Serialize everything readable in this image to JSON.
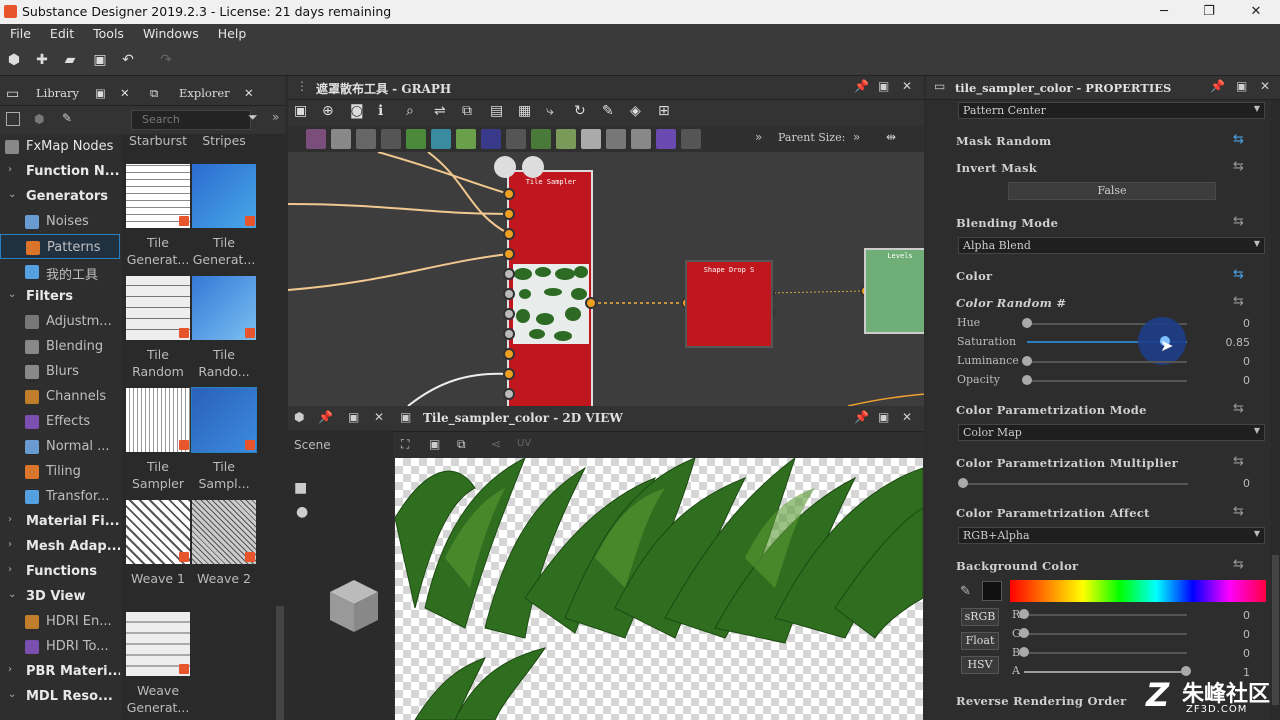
{
  "app": {
    "title": "Substance Designer 2019.2.3 - License: 21 days remaining"
  },
  "menu": [
    "File",
    "Edit",
    "Tools",
    "Windows",
    "Help"
  ],
  "library": {
    "tab_library": "Library",
    "tab_explorer": "Explorer",
    "search_placeholder": "Search",
    "tree": [
      {
        "label": "FxMap Nodes",
        "kind": "top"
      },
      {
        "label": "Function N...",
        "kind": "cat"
      },
      {
        "label": "Generators",
        "kind": "cat",
        "open": true
      },
      {
        "label": "Noises",
        "kind": "sub"
      },
      {
        "label": "Patterns",
        "kind": "sub",
        "selected": true
      },
      {
        "label": "我的工具",
        "kind": "sub"
      },
      {
        "label": "Filters",
        "kind": "cat",
        "open": true
      },
      {
        "label": "Adjustm...",
        "kind": "sub"
      },
      {
        "label": "Blending",
        "kind": "sub"
      },
      {
        "label": "Blurs",
        "kind": "sub"
      },
      {
        "label": "Channels",
        "kind": "sub"
      },
      {
        "label": "Effects",
        "kind": "sub"
      },
      {
        "label": "Normal ...",
        "kind": "sub"
      },
      {
        "label": "Tiling",
        "kind": "sub"
      },
      {
        "label": "Transfor...",
        "kind": "sub"
      },
      {
        "label": "Material Fi...",
        "kind": "cat"
      },
      {
        "label": "Mesh Adap...",
        "kind": "cat"
      },
      {
        "label": "Functions",
        "kind": "cat"
      },
      {
        "label": "3D View",
        "kind": "cat",
        "open": true
      },
      {
        "label": "HDRI En...",
        "kind": "sub"
      },
      {
        "label": "HDRI To...",
        "kind": "sub"
      },
      {
        "label": "PBR Materi...",
        "kind": "cat"
      },
      {
        "label": "MDL Reso...",
        "kind": "cat",
        "open": true
      }
    ],
    "thumbs_top": [
      "Starburst",
      "Stripes"
    ],
    "thumbs": [
      {
        "line1": "Tile",
        "line2": "Generat..."
      },
      {
        "line1": "Tile",
        "line2": "Generat..."
      },
      {
        "line1": "Tile",
        "line2": "Random"
      },
      {
        "line1": "Tile",
        "line2": "Rando..."
      },
      {
        "line1": "Tile",
        "line2": "Sampler"
      },
      {
        "line1": "Tile",
        "line2": "Sampl..."
      },
      {
        "line1": "Weave 1",
        "line2": ""
      },
      {
        "line1": "Weave 2",
        "line2": ""
      },
      {
        "line1": "Weave",
        "line2": "Generat..."
      }
    ]
  },
  "graph": {
    "title": "遮罩散布工具 - GRAPH",
    "parent_size": "Parent Size:",
    "nodes": {
      "tile_sampler": "Tile Sampler",
      "shape_drop": "Shape Drop S",
      "levels": "Levels"
    }
  },
  "view2d": {
    "title": "Tile_sampler_color - 2D VIEW",
    "scene": "Scene",
    "uv": "UV"
  },
  "props": {
    "title": "tile_sampler_color - PROPERTIES",
    "pattern_center": "Pattern Center",
    "mask_random": "Mask Random",
    "invert_mask": "Invert Mask",
    "invert_mask_value": "False",
    "blending_mode": "Blending Mode",
    "blending_mode_value": "Alpha Blend",
    "color": "Color",
    "color_random": "Color Random #",
    "hue": "Hue",
    "hue_val": "0",
    "saturation": "Saturation",
    "saturation_val": "0.85",
    "luminance": "Luminance",
    "luminance_val": "0",
    "opacity": "Opacity",
    "opacity_val": "0",
    "cp_mode": "Color Parametrization Mode",
    "cp_mode_value": "Color Map",
    "cp_mult": "Color Parametrization Multiplier",
    "cp_mult_val": "0",
    "cp_affect": "Color Parametrization Affect",
    "cp_affect_value": "RGB+Alpha",
    "bg_color": "Background Color",
    "srgb": "sRGB",
    "float": "Float",
    "hsv": "HSV",
    "r": "R",
    "g": "G",
    "b": "B",
    "a": "A",
    "r_val": "0",
    "g_val": "0",
    "b_val": "0",
    "a_val": "1",
    "reverse": "Reverse Rendering Order",
    "saturation_level": 0.85
  },
  "watermark": {
    "brand": "朱峰社区",
    "site": "ZF3D.COM"
  }
}
